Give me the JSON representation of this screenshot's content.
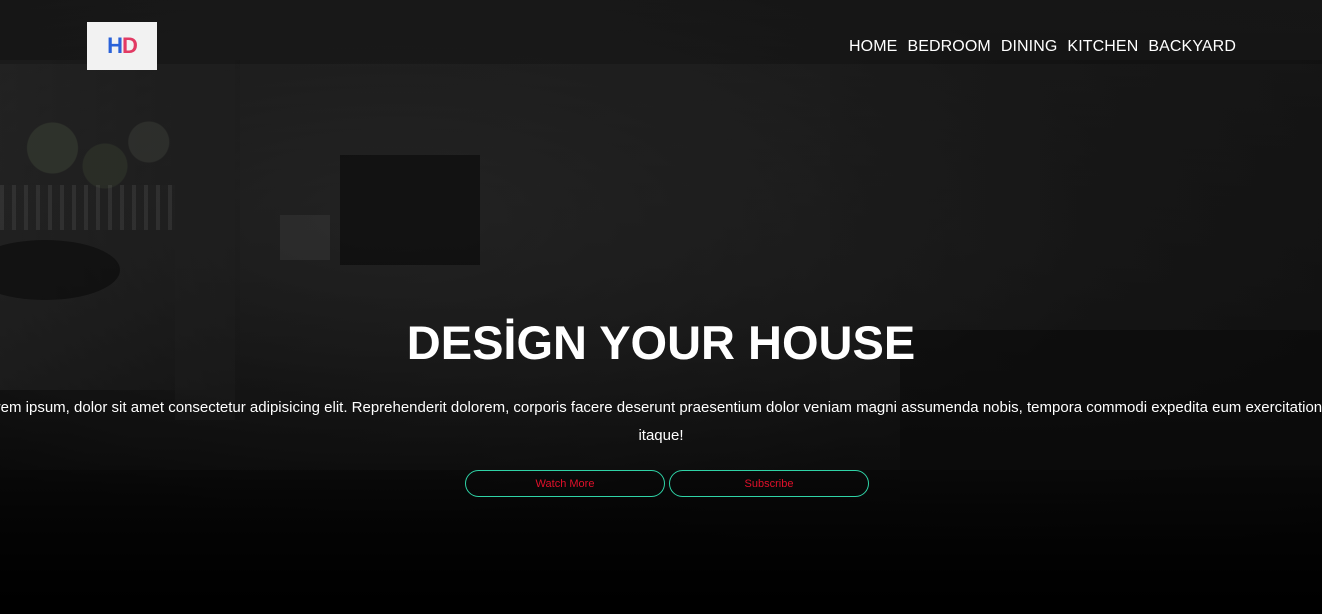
{
  "logo": {
    "letter_h": "H",
    "letter_d": "D",
    "colors": {
      "h": "#2a62d9",
      "d": "#e23a64",
      "background": "#f2f2f2"
    }
  },
  "nav": {
    "items": [
      {
        "label": "HOME"
      },
      {
        "label": "BEDROOM"
      },
      {
        "label": "DINING"
      },
      {
        "label": "KITCHEN"
      },
      {
        "label": "BACKYARD"
      }
    ]
  },
  "hero": {
    "title": "DESİGN YOUR HOUSE",
    "text": "Lorem ipsum, dolor sit amet consectetur adipisicing elit. Reprehenderit dolorem, corporis facere deserunt praesentium dolor veniam magni assumenda nobis, tempora commodi expedita eum exercitationem itaque!",
    "buttons": {
      "watch_more": "Watch More",
      "subscribe": "Subscribe"
    }
  },
  "colors": {
    "button_border": "#2fd3a6",
    "button_text": "#e0102a",
    "text": "#ffffff"
  }
}
